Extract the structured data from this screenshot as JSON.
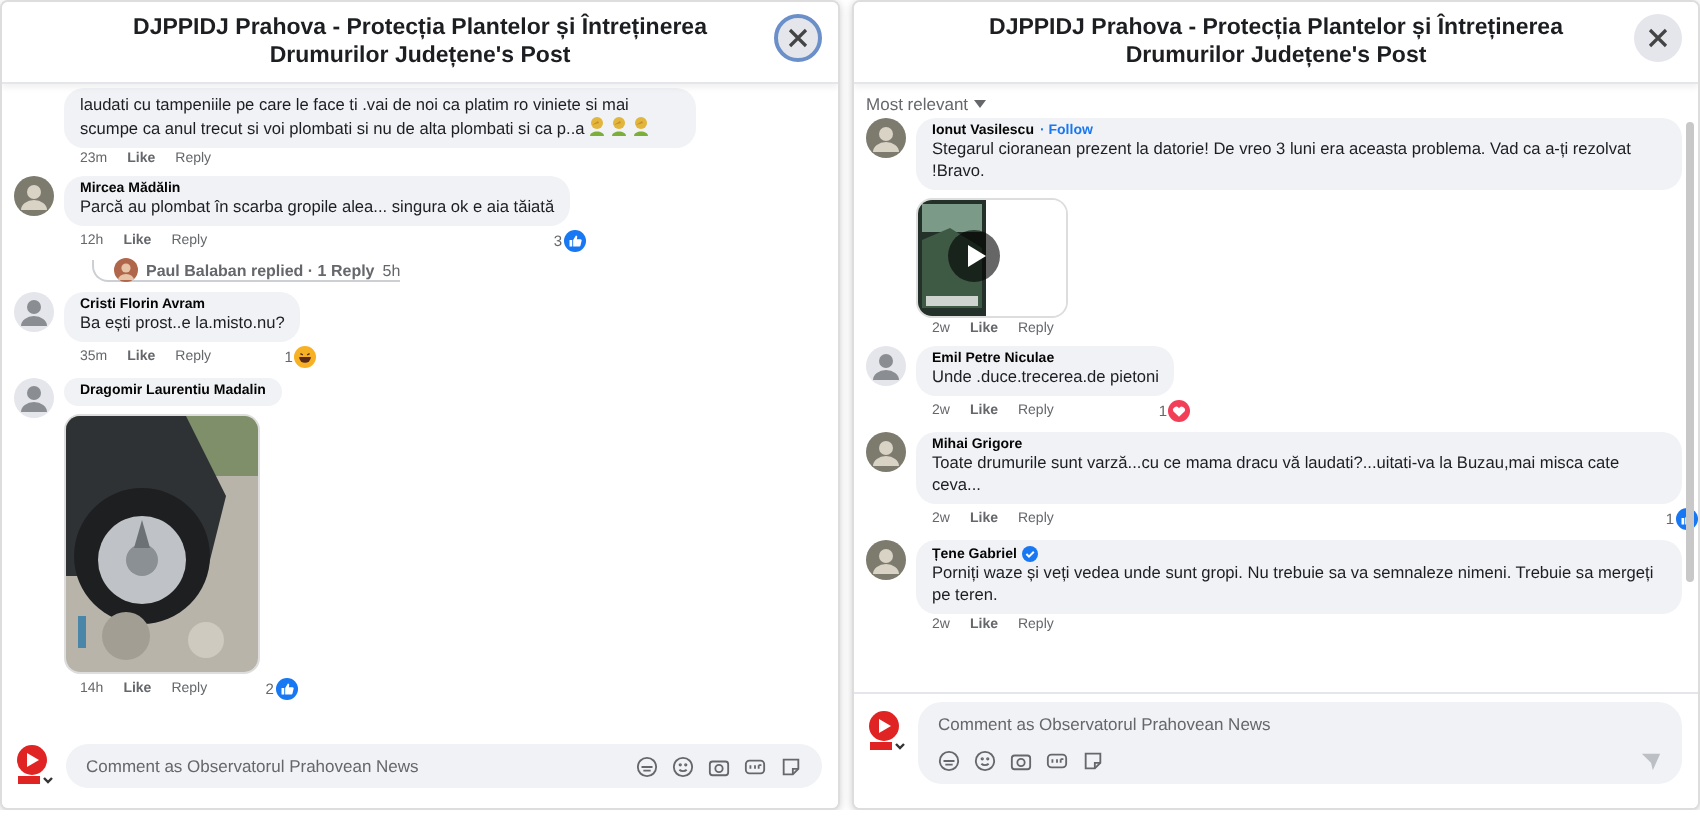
{
  "panels": [
    {
      "title": "DJPPIDJ Prahova - Protecția Plantelor și Întreținerea Drumurilor Județene's Post",
      "close_focused": true,
      "composer": {
        "placeholder": "Comment as Observatorul Prahovean News",
        "kind": "inline"
      },
      "comments": [
        {
          "text": "laudati cu tampeniile pe care le face ti .vai de noi ca platim ro viniete si mai scumpe ca anul trecut si voi plombati si nu de alta plombati si ca p..a",
          "emoji": {
            "kind": "facepalm"
          },
          "time": "23m",
          "actions": [
            "Like",
            "Reply"
          ]
        },
        {
          "author": "Mircea Mădălin",
          "text": "Parcă au plombat în scarba gropile alea... singura ok e aia tăiată",
          "time": "12h",
          "actions": [
            "Like",
            "Reply"
          ],
          "reaction": {
            "count": "3",
            "kind": "like"
          },
          "reply_summary": {
            "text": "Paul Balaban replied · 1 Reply",
            "time": "5h"
          }
        },
        {
          "avatar": {
            "kind": "default"
          },
          "author": "Cristi Florin Avram",
          "text": "Ba ești prost..e la.misto.nu?",
          "time": "35m",
          "actions": [
            "Like",
            "Reply"
          ],
          "reaction": {
            "count": "1",
            "kind": "haha"
          }
        },
        {
          "avatar": {
            "kind": "default"
          },
          "author": "Dragomir Laurentiu Madalin",
          "time": "14h",
          "actions": [
            "Like",
            "Reply"
          ],
          "reaction": {
            "count": "2",
            "kind": "like"
          }
        }
      ]
    },
    {
      "title": "DJPPIDJ Prahova - Protecția Plantelor și Întreținerea Drumurilor Județene's Post",
      "close_focused": false,
      "sort": "Most relevant",
      "composer": {
        "placeholder": "Comment as Observatorul Prahovean News",
        "kind": "stacked"
      },
      "comments": [
        {
          "author": "Ionut Vasilescu",
          "follow": "· Follow",
          "text": "Stegarul cioranean prezent la datorie! De vreo 3 luni era aceasta problema. Vad ca a-ți rezolvat !Bravo.",
          "attachment": {
            "kind": "video"
          },
          "time": "2w",
          "actions": [
            "Like",
            "Reply"
          ]
        },
        {
          "avatar": {
            "kind": "default"
          },
          "author": "Emil Petre Niculae",
          "text": "Unde .duce.trecerea.de pietoni",
          "time": "2w",
          "actions": [
            "Like",
            "Reply"
          ],
          "reaction": {
            "count": "1",
            "kind": "love"
          }
        },
        {
          "author": "Mihai Grigore",
          "text": "Toate drumurile sunt varză...cu ce mama dracu vă laudati?...uitati-va la Buzau,mai misca cate ceva...",
          "time": "2w",
          "actions": [
            "Like",
            "Reply"
          ],
          "reaction": {
            "count": "1",
            "kind": "like"
          }
        },
        {
          "author": "Țene Gabriel",
          "verified": true,
          "text": "Porniți waze și veți vedea unde sunt gropi. Nu trebuie sa va semnaleze nimeni. Trebuie sa mergeți pe teren.",
          "time": "2w",
          "actions": [
            "Like",
            "Reply"
          ]
        }
      ]
    }
  ]
}
